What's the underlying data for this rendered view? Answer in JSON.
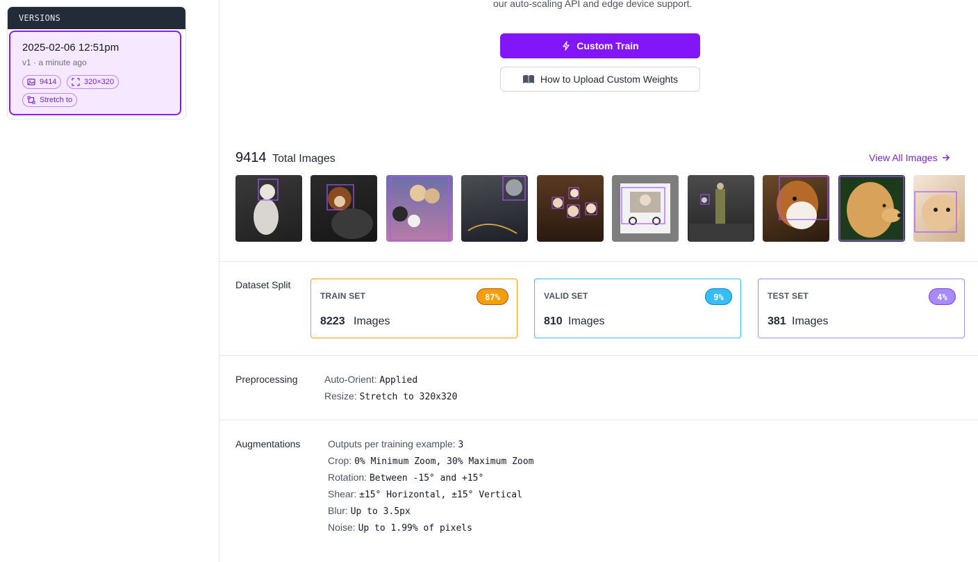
{
  "sidebar": {
    "header": "VERSIONS",
    "version": {
      "title": "2025-02-06 12:51pm",
      "subtitle": "v1 · a minute ago",
      "chips": {
        "images": "9414",
        "size": "320×320",
        "resize": "Stretch to"
      }
    }
  },
  "intro": {
    "text": "our auto-scaling API and edge device support."
  },
  "buttons": {
    "custom_train": "Custom Train",
    "upload_weights": "How to Upload Custom Weights"
  },
  "images": {
    "count": "9414",
    "label": "Total Images",
    "view_all": "View All Images"
  },
  "split": {
    "label": "Dataset Split",
    "train": {
      "name": "TRAIN SET",
      "percent": "87%",
      "count": "8223",
      "unit": "Images",
      "color": "#f59e0b"
    },
    "valid": {
      "name": "VALID SET",
      "percent": "9%",
      "count": "810",
      "unit": "Images",
      "color": "#38bdf8"
    },
    "test": {
      "name": "TEST SET",
      "percent": "4%",
      "count": "381",
      "unit": "Images",
      "color": "#a78bfa"
    }
  },
  "preprocessing": {
    "label": "Preprocessing",
    "items": [
      {
        "key": "Auto-Orient:",
        "value": "Applied"
      },
      {
        "key": "Resize:",
        "value": "Stretch to 320x320"
      }
    ]
  },
  "augmentations": {
    "label": "Augmentations",
    "items": [
      {
        "key": "Outputs per training example:",
        "value": "3"
      },
      {
        "key": "Crop:",
        "value": "0% Minimum Zoom, 30% Maximum Zoom"
      },
      {
        "key": "Rotation:",
        "value": "Between -15° and +15°"
      },
      {
        "key": "Shear:",
        "value": "±15° Horizontal, ±15° Vertical"
      },
      {
        "key": "Blur:",
        "value": "Up to 3.5px"
      },
      {
        "key": "Noise:",
        "value": "Up to 1.99% of pixels"
      }
    ]
  },
  "colors": {
    "accent": "#8315f9",
    "link": "#7e22ce",
    "sidebar_header": "#222b38"
  },
  "icons": [
    "lightning-icon",
    "book-icon",
    "image-icon",
    "resize-icon",
    "crop-icon",
    "arrow-right-icon"
  ]
}
